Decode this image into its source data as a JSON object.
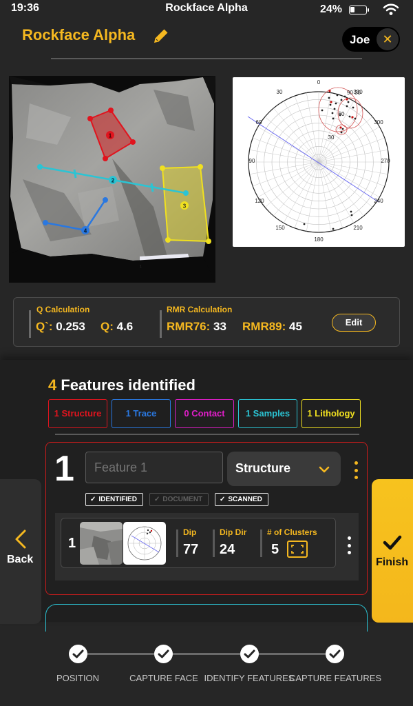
{
  "status_bar": {
    "time": "19:36",
    "app_title": "Rockface Alpha",
    "battery": "24%"
  },
  "header": {
    "title": "Rockface Alpha",
    "user": "Joe",
    "close_glyph": "✕"
  },
  "stereonet": {
    "labels": [
      "0",
      "30",
      "60",
      "90",
      "120",
      "150",
      "180",
      "210",
      "240",
      "270",
      "300",
      "330",
      "90 30",
      "60",
      "30"
    ]
  },
  "face_markers": [
    "1",
    "2",
    "3",
    "4",
    "1"
  ],
  "calc": {
    "q_label": "Q Calculation",
    "q_prime_key": "Q`:",
    "q_prime_value": "0.253",
    "q_key": "Q:",
    "q_value": "4.6",
    "rmr_label": "RMR Calculation",
    "rmr76_key": "RMR76:",
    "rmr76_value": "33",
    "rmr89_key": "RMR89:",
    "rmr89_value": "45",
    "edit_label": "Edit"
  },
  "features": {
    "count": "4",
    "title_suffix": " Features identified",
    "chips": [
      {
        "label": "1 Structure",
        "color": "#e0141e"
      },
      {
        "label": "1 Trace",
        "color": "#2a78e0"
      },
      {
        "label": "0 Contact",
        "color": "#e01ec8"
      },
      {
        "label": "1 Samples",
        "color": "#2bc4d4"
      },
      {
        "label": "1 Lithology",
        "color": "#f0e020"
      }
    ]
  },
  "card": {
    "number": "1",
    "name_placeholder": "Feature 1",
    "type_value": "Structure",
    "flags": [
      "IDENTIFIED",
      "DOCUMENT",
      "SCANNED"
    ],
    "flag_check": "✓",
    "row": {
      "index": "1",
      "dip_label": "Dip",
      "dip_value": "77",
      "dipdir_label": "Dip Dir",
      "dipdir_value": "24",
      "clusters_label": "# of Clusters",
      "clusters_value": "5"
    }
  },
  "nav": {
    "back": "Back",
    "finish": "Finish"
  },
  "steps": [
    "POSITION",
    "CAPTURE FACE",
    "IDENTIFY FEATURES",
    "CAPTURE FEATURES"
  ],
  "colors": {
    "accent": "#f5b820",
    "structure": "#e0141e",
    "trace": "#2a78e0",
    "samples": "#2bc4d4",
    "lithology": "#f0e020"
  },
  "icons": [
    "wifi-icon",
    "battery-icon",
    "pencil-icon",
    "close-icon",
    "chevron-down-icon",
    "kebab-icon",
    "check-icon",
    "cluster-frame-icon",
    "back-arrow-icon"
  ]
}
